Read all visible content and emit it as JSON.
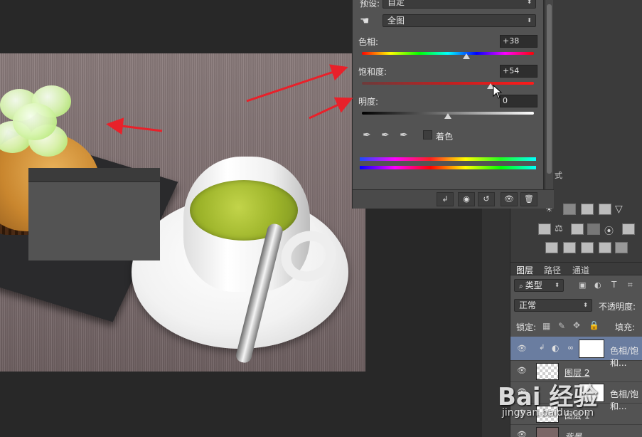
{
  "properties": {
    "preset_label": "预设:",
    "preset_value": "自定",
    "range_value": "全图",
    "hue_label": "色相:",
    "hue_value": "+38",
    "sat_label": "饱和度:",
    "sat_value": "+54",
    "light_label": "明度:",
    "light_value": "0",
    "colorize_label": "着色",
    "hue": 38,
    "saturation": 54,
    "lightness": 0
  },
  "dock": {
    "adjustments_tab": "式"
  },
  "layers_panel": {
    "tabs": [
      "图层",
      "路径",
      "通道"
    ],
    "filter_kind": "类型",
    "blend_mode": "正常",
    "opacity_label": "不透明度:",
    "lock_label": "锁定:",
    "fill_label": "填充:",
    "layers": [
      {
        "name": "色相/饱和...",
        "type": "adjustment",
        "selected": true
      },
      {
        "name": "图层 2",
        "type": "pixel",
        "selected": false
      },
      {
        "name": "色相/饱和...",
        "type": "adjustment",
        "selected": false
      },
      {
        "name": "图层 1",
        "type": "pixel",
        "selected": false
      },
      {
        "name": "背景",
        "type": "background",
        "selected": false
      }
    ]
  },
  "watermark": {
    "brand": "Bai 经验",
    "url": "jingyan.baidu.com"
  },
  "colors": {
    "selected_layer": "#6a7da0",
    "arrow": "#e8212a",
    "panel_bg": "#535353"
  }
}
